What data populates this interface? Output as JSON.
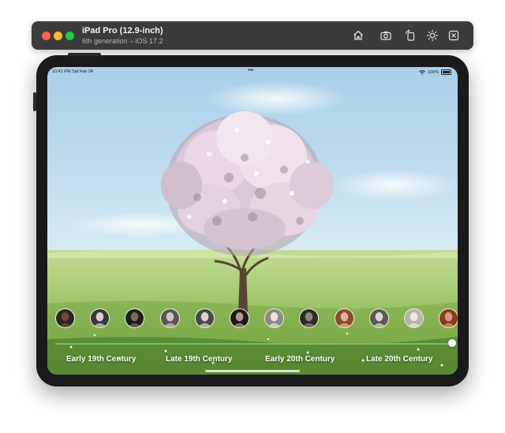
{
  "simulator": {
    "device_name": "iPad Pro (12.9-inch)",
    "device_subtitle": "6th generation – iOS 17.2",
    "toolbar_icons": [
      "home-icon",
      "screenshot-icon",
      "rotate-icon",
      "appearance-icon",
      "side-button-icon"
    ]
  },
  "status_bar": {
    "time": "10:41 PM  Sat Feb 24",
    "dots": "•••",
    "battery": "100%"
  },
  "scene": {
    "sky_color": "#bcd9ec",
    "grass_color": "#9cc464",
    "blossom_color": "#ead6e6",
    "trunk_color": "#5a4532"
  },
  "portraits": [
    {
      "id": "p1",
      "skin": "#6b4a3a",
      "bg": "#2a2622"
    },
    {
      "id": "p2",
      "skin": "#d6d0c8",
      "bg": "#3a3a3a"
    },
    {
      "id": "p3",
      "skin": "#7b6a5e",
      "bg": "#1f1d1b"
    },
    {
      "id": "p4",
      "skin": "#cfc8be",
      "bg": "#5a5652"
    },
    {
      "id": "p5",
      "skin": "#d8d4ce",
      "bg": "#4a4845"
    },
    {
      "id": "p6",
      "skin": "#a89a8c",
      "bg": "#1c1a18"
    },
    {
      "id": "p7",
      "skin": "#e5e2dd",
      "bg": "#8c8a86"
    },
    {
      "id": "p8",
      "skin": "#8e8276",
      "bg": "#2d2b29"
    },
    {
      "id": "p9",
      "skin": "#e0b49a",
      "bg": "#8a4b2e"
    },
    {
      "id": "p10",
      "skin": "#d9d4cc",
      "bg": "#5d5a56"
    },
    {
      "id": "p11",
      "skin": "#ece8e2",
      "bg": "#b8b3ac"
    },
    {
      "id": "p12",
      "skin": "#d39a7a",
      "bg": "#8b3d22"
    }
  ],
  "eras": [
    {
      "label": "Early 19th Century"
    },
    {
      "label": "Late 19th Century"
    },
    {
      "label": "Early 20th Century"
    },
    {
      "label": "Late 20th Century"
    }
  ]
}
